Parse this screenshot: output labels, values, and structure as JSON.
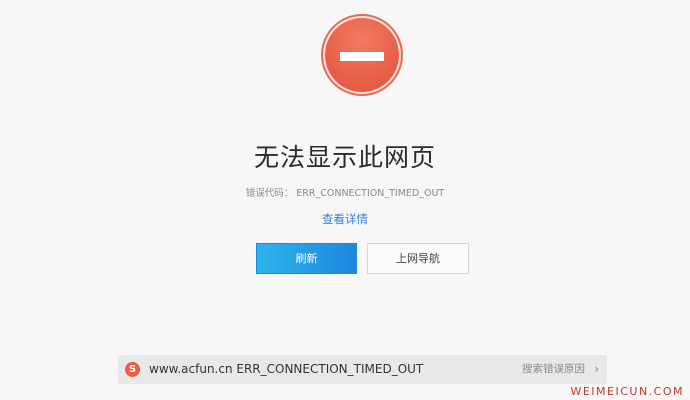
{
  "error_page": {
    "title": "无法显示此网页",
    "error_code": "错误代码： ERR_CONNECTION_TIMED_OUT",
    "details_link": "查看详情",
    "refresh_button": "刷新",
    "navigate_button": "上网导航"
  },
  "status_bar": {
    "icon": "sogou-icon",
    "icon_glyph": "S",
    "message": "www.acfun.cn ERR_CONNECTION_TIMED_OUT",
    "search_reason": "搜索错误原因",
    "chevron": "›"
  },
  "watermark": "WEIMEICUN.COM",
  "colors": {
    "accent_blue": "#1d86de",
    "error_red": "#e8604a",
    "link_blue": "#2e86d8"
  }
}
